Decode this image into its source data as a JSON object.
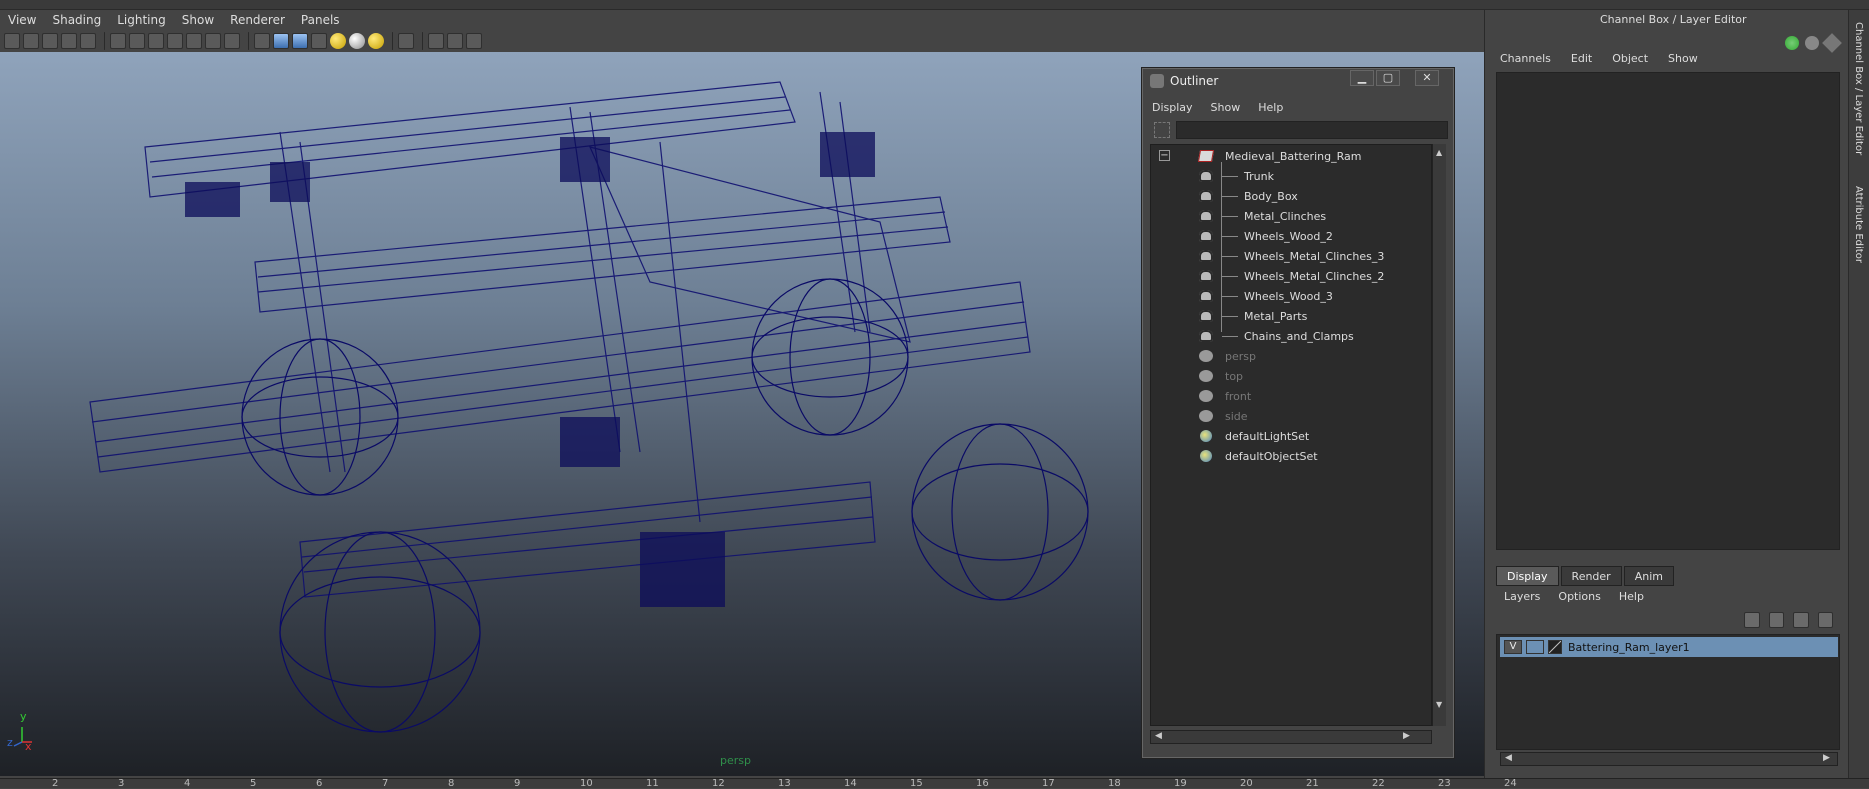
{
  "viewport": {
    "menu": [
      "View",
      "Shading",
      "Lighting",
      "Show",
      "Renderer",
      "Panels"
    ],
    "camera_label": "persp",
    "axes": {
      "x": "x",
      "y": "y",
      "z": "z"
    }
  },
  "outliner": {
    "title": "Outliner",
    "window_buttons": {
      "min": "▁",
      "max": "▢",
      "close": "✕"
    },
    "menu": [
      "Display",
      "Show",
      "Help"
    ],
    "search_value": "",
    "root": "Medieval_Battering_Ram",
    "children": [
      "Trunk",
      "Body_Box",
      "Metal_Clinches",
      "Wheels_Wood_2",
      "Wheels_Metal_Clinches_3",
      "Wheels_Metal_Clinches_2",
      "Wheels_Wood_3",
      "Metal_Parts",
      "Chains_and_Clamps"
    ],
    "cameras": [
      "persp",
      "top",
      "front",
      "side"
    ],
    "sets": [
      "defaultLightSet",
      "defaultObjectSet"
    ],
    "collapse_symbol": "−"
  },
  "channel_box": {
    "title": "Channel Box / Layer Editor",
    "menu": [
      "Channels",
      "Edit",
      "Object",
      "Show"
    ],
    "tabs": [
      "Display",
      "Render",
      "Anim"
    ],
    "active_tab": "Display",
    "layer_menu": [
      "Layers",
      "Options",
      "Help"
    ],
    "layer": {
      "visible": "V",
      "name": "Battering_Ram_layer1"
    }
  },
  "side_tabs": [
    "Channel Box / Layer Editor",
    "Attribute Editor"
  ],
  "ruler": [
    "2",
    "3",
    "4",
    "5",
    "6",
    "7",
    "8",
    "9",
    "10",
    "11",
    "12",
    "13",
    "14",
    "15",
    "16",
    "17",
    "18",
    "19",
    "20",
    "21",
    "22",
    "23",
    "24"
  ]
}
